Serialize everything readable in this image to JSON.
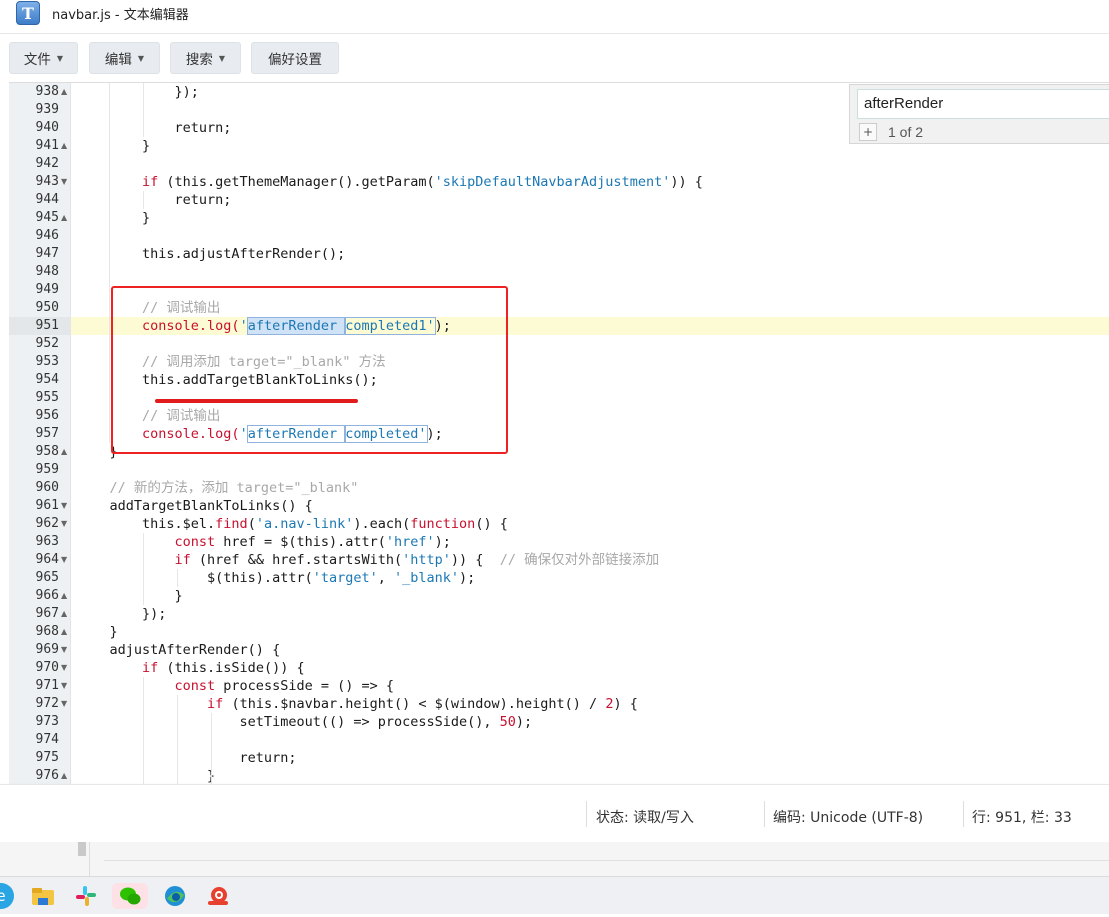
{
  "window": {
    "title": "navbar.js - 文本编辑器",
    "icon": "text-editor-icon"
  },
  "menu": {
    "file": "文件",
    "edit": "编辑",
    "search": "搜索",
    "prefs": "偏好设置"
  },
  "search": {
    "query": "afterRender",
    "count": "1 of 2",
    "plus": "+"
  },
  "status": {
    "mode": "状态: 读取/写入",
    "encoding": "编码: Unicode (UTF-8)",
    "position": "行: 951, 栏: 33"
  },
  "editor": {
    "current_line": 951,
    "lines": [
      {
        "n": "938",
        "f": "up"
      },
      {
        "n": "939",
        "f": ""
      },
      {
        "n": "940",
        "f": ""
      },
      {
        "n": "941",
        "f": "up"
      },
      {
        "n": "942",
        "f": ""
      },
      {
        "n": "943",
        "f": "down"
      },
      {
        "n": "944",
        "f": ""
      },
      {
        "n": "945",
        "f": "up"
      },
      {
        "n": "946",
        "f": ""
      },
      {
        "n": "947",
        "f": ""
      },
      {
        "n": "948",
        "f": ""
      },
      {
        "n": "949",
        "f": ""
      },
      {
        "n": "950",
        "f": ""
      },
      {
        "n": "951",
        "f": ""
      },
      {
        "n": "952",
        "f": ""
      },
      {
        "n": "953",
        "f": ""
      },
      {
        "n": "954",
        "f": ""
      },
      {
        "n": "955",
        "f": ""
      },
      {
        "n": "956",
        "f": ""
      },
      {
        "n": "957",
        "f": ""
      },
      {
        "n": "958",
        "f": "up"
      },
      {
        "n": "959",
        "f": ""
      },
      {
        "n": "960",
        "f": ""
      },
      {
        "n": "961",
        "f": "down"
      },
      {
        "n": "962",
        "f": "down"
      },
      {
        "n": "963",
        "f": ""
      },
      {
        "n": "964",
        "f": "down"
      },
      {
        "n": "965",
        "f": ""
      },
      {
        "n": "966",
        "f": "up"
      },
      {
        "n": "967",
        "f": "up"
      },
      {
        "n": "968",
        "f": "up"
      },
      {
        "n": "969",
        "f": "down"
      },
      {
        "n": "970",
        "f": "down"
      },
      {
        "n": "971",
        "f": "down"
      },
      {
        "n": "972",
        "f": "down"
      },
      {
        "n": "973",
        "f": ""
      },
      {
        "n": "974",
        "f": ""
      },
      {
        "n": "975",
        "f": ""
      },
      {
        "n": "976",
        "f": "up"
      }
    ],
    "code": {
      "l938": "            });",
      "l940": "            return;",
      "l941": "        }",
      "l943a": "        if",
      "l943b": " (this.getThemeManager().getParam(",
      "l943c": "'skipDefaultNavbarAdjustment'",
      "l943d": ")) {",
      "l944": "            return;",
      "l945": "        }",
      "l947": "        this.adjustAfterRender();",
      "l950": "        // 调试输出",
      "l951a": "        console.log(",
      "l951b": "'",
      "l951c": "afterRender ",
      "l951d": "completed1'",
      "l951e": ");",
      "l953": "        // 调用添加 target=\"_blank\" 方法",
      "l954": "        this.addTargetBlankToLinks();",
      "l956": "        // 调试输出",
      "l957a": "        console.log(",
      "l957b": "'",
      "l957c": "afterRender ",
      "l957d": "completed'",
      "l957e": ");",
      "l958": "    }",
      "l960": "    // 新的方法，添加 target=\"_blank\"",
      "l961": "    addTargetBlankToLinks() {",
      "l962a": "        this.$el.",
      "l962b": "find",
      "l962c": "(",
      "l962d": "'a.nav-link'",
      "l962e": ").each(",
      "l962f": "function",
      "l962g": "() {",
      "l963a": "            const",
      "l963b": " href = $(this).attr(",
      "l963c": "'href'",
      "l963d": ");",
      "l964a": "            if",
      "l964b": " (href && href.startsWith(",
      "l964c": "'http'",
      "l964d": ")) {  ",
      "l964e": "// 确保仅对外部链接添加",
      "l965a": "                $(this).attr(",
      "l965b": "'target'",
      "l965c": ", ",
      "l965d": "'_blank'",
      "l965e": ");",
      "l966": "            }",
      "l967": "        });",
      "l968": "    }",
      "l969": "    adjustAfterRender() {",
      "l970a": "        if",
      "l970b": " (this.isSide()) {",
      "l971a": "            const",
      "l971b": " processSide = () => {",
      "l972a": "                if",
      "l972b": " (this.$navbar.height() < $(window).height() / ",
      "l972c": "2",
      "l972d": ") {",
      "l973a": "                    setTimeout(() => processSide(), ",
      "l973b": "50",
      "l973c": ");",
      "l975": "                    return;",
      "l976": "                }"
    }
  },
  "taskbar": {
    "icons": [
      "edge-partial-icon",
      "file-explorer-icon",
      "slack-icon",
      "wechat-icon",
      "edge-icon",
      "snail-app-icon"
    ]
  }
}
